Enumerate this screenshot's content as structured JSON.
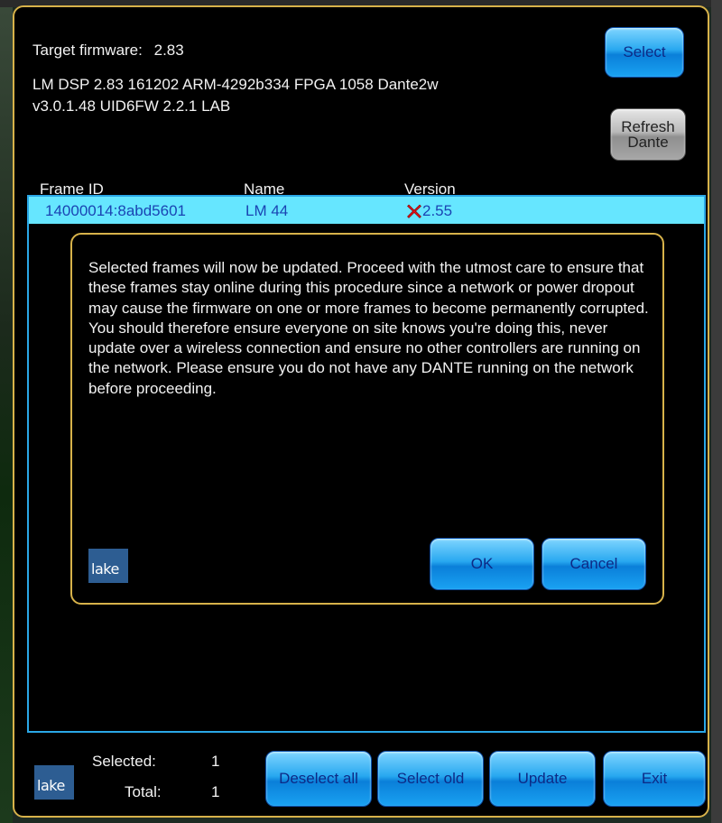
{
  "header": {
    "target_firmware_label": "Target firmware:",
    "target_firmware_value": "2.83",
    "firmware_line1": "LM DSP 2.83 161202 ARM-4292b334 FPGA 1058 Dante2w",
    "firmware_line2": "v3.0.1.48 UID6FW 2.2.1  LAB"
  },
  "buttons": {
    "select": "Select",
    "refresh_line1": "Refresh",
    "refresh_line2": "Dante",
    "deselect_all": "Deselect all",
    "select_old": "Select old",
    "update": "Update",
    "exit": "Exit"
  },
  "table": {
    "columns": [
      "Frame ID",
      "Name",
      "Version"
    ],
    "rows": [
      {
        "frame_id": "14000014:8abd5601",
        "name": "LM 44",
        "version": "2.55",
        "status_icon": "error-x-icon"
      }
    ]
  },
  "dialog": {
    "message": "Selected frames will now be updated. Proceed with the utmost care to ensure that these frames stay online during this procedure since a network or power dropout may cause the firmware on one or more frames to become permanently corrupted. You should therefore ensure everyone on site knows you're doing this, never update over a wireless connection and ensure no other controllers are running on the network. Please ensure you do not have any DANTE running on the network before proceeding.",
    "ok": "OK",
    "cancel": "Cancel",
    "logo_text": "lake"
  },
  "footer": {
    "selected_label": "Selected:",
    "selected_value": "1",
    "total_label": "Total:",
    "total_value": "1",
    "logo_text": "lake"
  },
  "colors": {
    "accent": "#2aa7e6",
    "border_gold": "#d7b24a",
    "row_highlight": "#66e6ff",
    "error": "#e0141b"
  }
}
